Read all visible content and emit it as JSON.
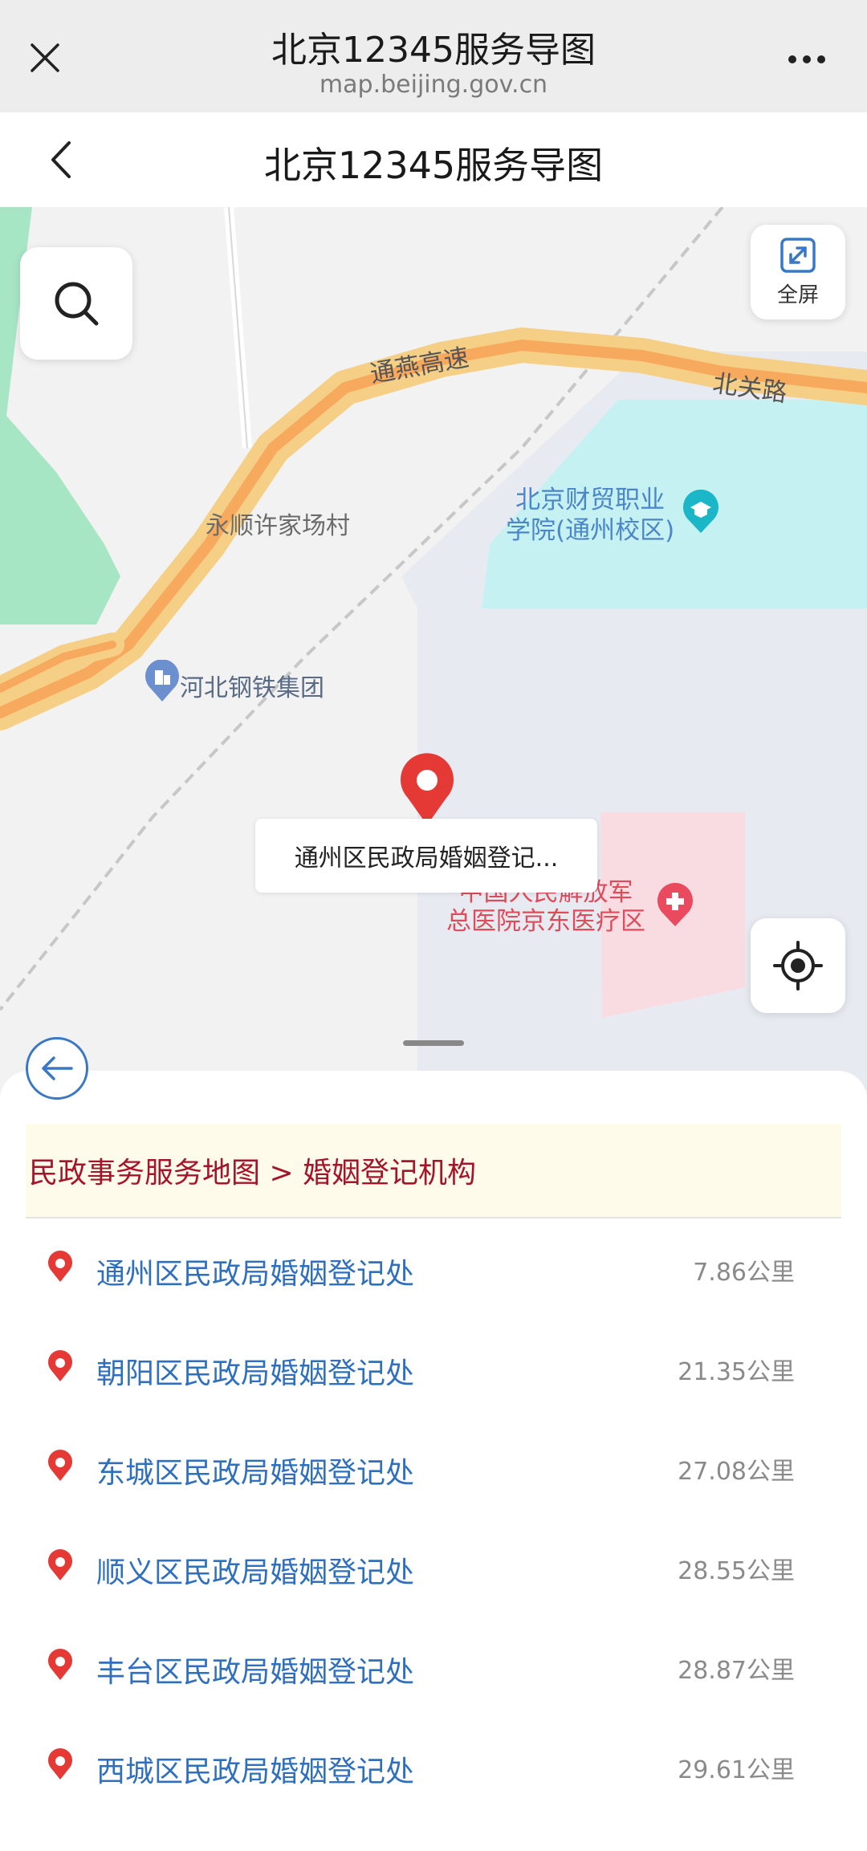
{
  "browser": {
    "title": "北京12345服务导图",
    "url": "map.beijing.gov.cn"
  },
  "header": {
    "title": "北京12345服务导图"
  },
  "map": {
    "roads": [
      "通燕高速",
      "北关路"
    ],
    "places": {
      "village": "永顺许家场村",
      "college_line1": "北京财贸职业",
      "college_line2": "学院(通州校区)",
      "company": "河北钢铁集团",
      "hospital_line1": "中国人民解放军",
      "hospital_line2": "总医院京东医疗区"
    },
    "pin_callout": "通州区民政局婚姻登记...",
    "fullscreen_label": "全屏"
  },
  "sheet": {
    "breadcrumb": "民政事务服务地图 > 婚姻登记机构",
    "items": [
      {
        "name": "通州区民政局婚姻登记处",
        "distance": "7.86公里"
      },
      {
        "name": "朝阳区民政局婚姻登记处",
        "distance": "21.35公里"
      },
      {
        "name": "东城区民政局婚姻登记处",
        "distance": "27.08公里"
      },
      {
        "name": "顺义区民政局婚姻登记处",
        "distance": "28.55公里"
      },
      {
        "name": "丰台区民政局婚姻登记处",
        "distance": "28.87公里"
      },
      {
        "name": "西城区民政局婚姻登记处",
        "distance": "29.61公里"
      }
    ]
  },
  "colors": {
    "accent_blue": "#2f6fbf",
    "pin_red": "#e53935",
    "breadcrumb_text": "#a4142a",
    "breadcrumb_bg": "#fffbea"
  }
}
